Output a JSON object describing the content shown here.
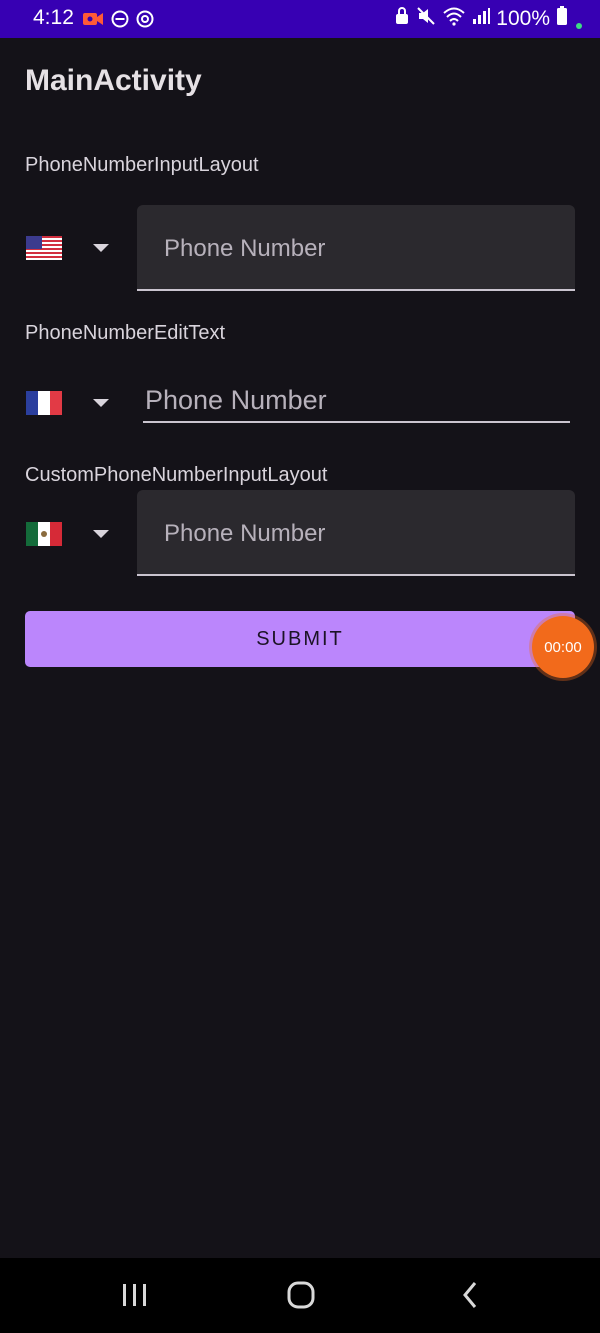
{
  "status_bar": {
    "time": "4:12",
    "battery": "100%",
    "icons": [
      "video-record-icon",
      "do-not-disturb-icon",
      "sync-icon",
      "lock-icon",
      "mute-icon",
      "wifi-icon",
      "signal-icon",
      "battery-icon"
    ]
  },
  "app": {
    "title": "MainActivity"
  },
  "sections": [
    {
      "label": "PhoneNumberInputLayout",
      "flag": "us-flag",
      "placeholder": "Phone Number",
      "value": ""
    },
    {
      "label": "PhoneNumberEditText",
      "flag": "fr-flag",
      "placeholder": "Phone Number",
      "value": ""
    },
    {
      "label": "CustomPhoneNumberInputLayout",
      "flag": "mx-flag",
      "placeholder": "Phone Number",
      "value": ""
    }
  ],
  "submit_label": "SUBMIT",
  "recorder": {
    "timer": "00:00"
  },
  "colors": {
    "status_bar": "#3700B3",
    "background": "#141218",
    "accent": "#BB86FC",
    "field_fill": "#2B292E",
    "recorder": "#F26A1B"
  },
  "nav_bar": {
    "icons": [
      "recent-apps-icon",
      "home-icon",
      "back-icon"
    ]
  }
}
